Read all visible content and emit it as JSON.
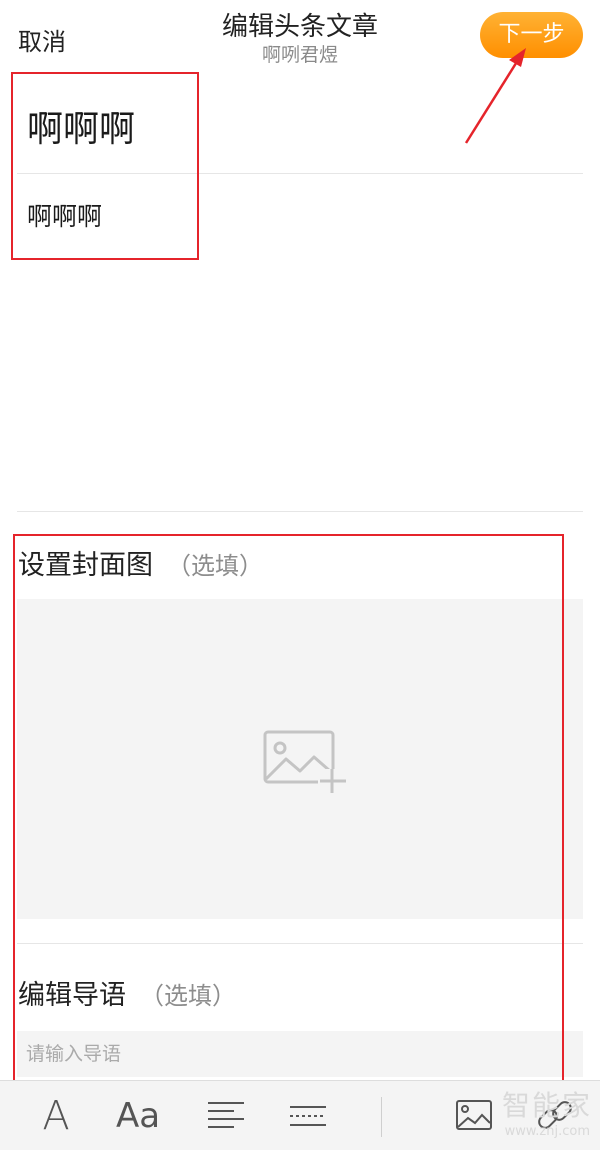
{
  "header": {
    "cancel_label": "取消",
    "title": "编辑头条文章",
    "subtitle": "啊咧君煜",
    "next_label": "下一步"
  },
  "article": {
    "title": "啊啊啊",
    "body": "啊啊啊"
  },
  "cover": {
    "label": "设置封面图",
    "optional": "（选填）",
    "icon": "image-add-icon"
  },
  "summary": {
    "label": "编辑导语",
    "optional": "（选填）",
    "placeholder": "请输入导语",
    "value": ""
  },
  "toolbar": {
    "items": [
      {
        "name": "font-icon",
        "glyph": "A"
      },
      {
        "name": "font-size-icon",
        "glyph": "Aa"
      },
      {
        "name": "align-icon"
      },
      {
        "name": "divider-line-icon"
      },
      {
        "name": "insert-image-icon"
      },
      {
        "name": "link-icon"
      }
    ]
  },
  "watermark": {
    "text": "智能家",
    "url": "www.znj.com"
  },
  "colors": {
    "accent": "#ff9a10",
    "annotation": "#e5242b",
    "placeholder_bg": "#f4f4f4"
  }
}
